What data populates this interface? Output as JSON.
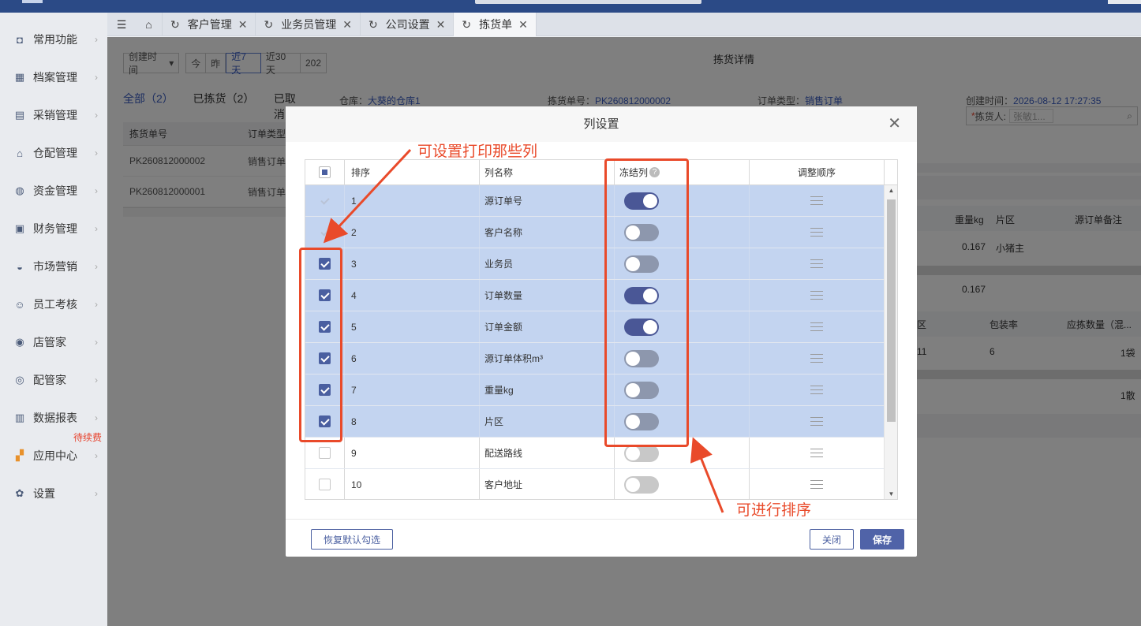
{
  "tabs": [
    {
      "label": "客户管理",
      "active": false
    },
    {
      "label": "业务员管理",
      "active": false
    },
    {
      "label": "公司设置",
      "active": false
    },
    {
      "label": "拣货单",
      "active": true
    }
  ],
  "sidebar": {
    "items": [
      {
        "label": "常用功能",
        "icon": "bookmark-icon"
      },
      {
        "label": "档案管理",
        "icon": "grid-icon"
      },
      {
        "label": "采销管理",
        "icon": "clipboard-icon"
      },
      {
        "label": "仓配管理",
        "icon": "warehouse-icon"
      },
      {
        "label": "资金管理",
        "icon": "money-bag-icon"
      },
      {
        "label": "财务管理",
        "icon": "calculator-icon"
      },
      {
        "label": "市场营销",
        "icon": "megaphone-icon"
      },
      {
        "label": "员工考核",
        "icon": "people-icon"
      },
      {
        "label": "店管家",
        "icon": "shop-icon"
      },
      {
        "label": "配管家",
        "icon": "location-icon"
      },
      {
        "label": "数据报表",
        "icon": "bar-chart-icon"
      },
      {
        "label": "应用中心",
        "icon": "apps-icon"
      },
      {
        "label": "设置",
        "icon": "gear-icon"
      }
    ],
    "badge": "待续费"
  },
  "list": {
    "filter_label": "创建时间",
    "date_buttons": [
      "今",
      "昨",
      "近7天",
      "近30天",
      "202"
    ],
    "subtabs": [
      "全部（2）",
      "已拣货（2）",
      "已取消"
    ],
    "headers": [
      "拣货单号",
      "订单类型"
    ],
    "rows": [
      [
        "PK260812000002",
        "销售订单"
      ],
      [
        "PK260812000001",
        "销售订单"
      ]
    ]
  },
  "detail": {
    "title": "拣货详情",
    "warehouse_label": "仓库：",
    "warehouse": "大葵的仓库1",
    "order_no_label": "拣货单号：",
    "order_no": "PK260812000002",
    "order_type_label": "订单类型：",
    "order_type": "销售订单",
    "created_label": "创建时间：",
    "created": "2026-08-12 17:27:35",
    "picker_label": "拣货人:",
    "picker_value": "张敏1...",
    "col_weight": "重量kg",
    "col_area": "片区",
    "col_remark": "源订单备注",
    "row_weight": "0.167",
    "row_area": "小猪主",
    "total_weight": "0.167",
    "col_area2": "区",
    "col_pack": "包装率",
    "col_qty": "应拣数量（混...",
    "r2_area": "11",
    "r2_pack": "6",
    "r2_qty": "1袋",
    "r3_qty": "1散"
  },
  "modal": {
    "title": "列设置",
    "headers": {
      "order": "排序",
      "name": "列名称",
      "freeze": "冻结列",
      "adjust": "调整顺序"
    },
    "rows": [
      {
        "no": "1",
        "name": "源订单号",
        "checked": true,
        "locked": true,
        "frozen": true
      },
      {
        "no": "2",
        "name": "客户名称",
        "checked": true,
        "locked": true,
        "frozen": false
      },
      {
        "no": "3",
        "name": "业务员",
        "checked": true,
        "locked": false,
        "frozen": false
      },
      {
        "no": "4",
        "name": "订单数量",
        "checked": true,
        "locked": false,
        "frozen": true
      },
      {
        "no": "5",
        "name": "订单金额",
        "checked": true,
        "locked": false,
        "frozen": true
      },
      {
        "no": "6",
        "name": "源订单体积m³",
        "checked": true,
        "locked": false,
        "frozen": false
      },
      {
        "no": "7",
        "name": "重量kg",
        "checked": true,
        "locked": false,
        "frozen": false
      },
      {
        "no": "8",
        "name": "片区",
        "checked": true,
        "locked": false,
        "frozen": false
      },
      {
        "no": "9",
        "name": "配送路线",
        "checked": false,
        "locked": false,
        "frozen": false
      },
      {
        "no": "10",
        "name": "客户地址",
        "checked": false,
        "locked": false,
        "frozen": false
      }
    ],
    "reset_label": "恢复默认勾选",
    "close_label": "关闭",
    "save_label": "保存"
  },
  "annotations": {
    "columns_note": "可设置打印那些列",
    "sort_note": "可进行排序",
    "color": "#e94a2a"
  }
}
